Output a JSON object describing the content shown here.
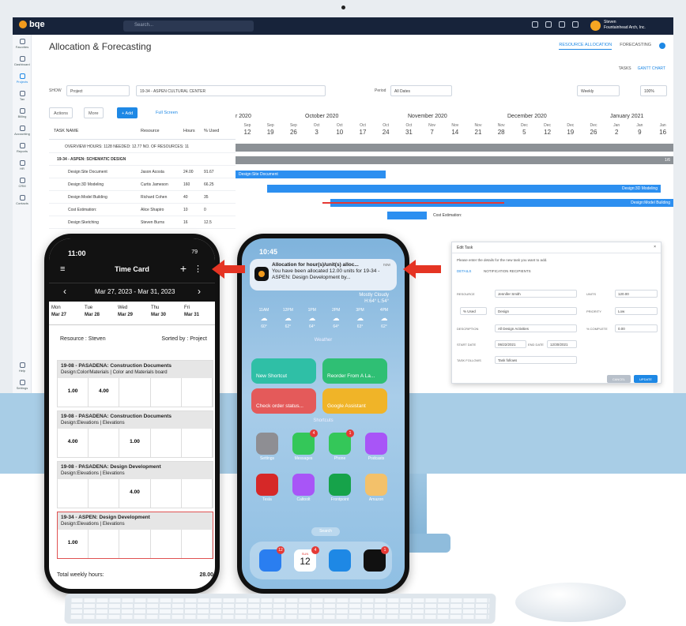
{
  "app": {
    "logo": "bqe",
    "search_placeholder": "Search...",
    "user_name": "Steven",
    "user_org": "Fountainhead Arch, Inc."
  },
  "sidebar": {
    "items": [
      "Favorites",
      "Dashboard",
      "Projects",
      "Tax",
      "Billing",
      "Accounting",
      "Reports",
      "HR",
      "CRM",
      "Contacts",
      "Help",
      "Settings"
    ]
  },
  "page": {
    "title": "Allocation & Forecasting",
    "tabs": [
      "RESOURCE ALLOCATION",
      "FORECASTING"
    ],
    "subtabs": [
      "TASKS",
      "GANTT CHART"
    ]
  },
  "filters": {
    "show_label": "SHOW",
    "show_value": "Project",
    "project": "19-34 - ASPEN CULTURAL CENTER",
    "period_label": "Period",
    "period_value": "All Dates",
    "weekly": "Weekly",
    "zoom": "100%"
  },
  "toolbar": {
    "actions": "Actions",
    "more": "More",
    "add": "+ Add",
    "fullscreen": "Full Screen"
  },
  "grid": {
    "headers": [
      "TASK NAME",
      "Resource",
      "Hours",
      "% Used"
    ],
    "overview": "OVERVIEW  HOURS: 1128  NEEDED: 12.77  NO. OF RESOURCES: 11",
    "group": "19-34 - ASPEN: SCHEMATIC DESIGN",
    "rows": [
      {
        "task": "Design:Site Document",
        "resource": "Jason Acosta",
        "hours": "24.00",
        "used": "91.67"
      },
      {
        "task": "Design:3D Modeling",
        "resource": "Curtis Jameson",
        "hours": "160",
        "used": "66.25"
      },
      {
        "task": "Design:Model Building",
        "resource": "Richard Cohen",
        "hours": "40",
        "used": "35"
      },
      {
        "task": "Cost Estimation:",
        "resource": "Alice Shapiro",
        "hours": "10",
        "used": "0"
      },
      {
        "task": "Design:Sketching",
        "resource": "Steven Burns",
        "hours": "16",
        "used": "12.5"
      }
    ]
  },
  "gantt": {
    "months": [
      "r 2020",
      "October 2020",
      "November 2020",
      "December 2020",
      "January 2021"
    ],
    "weeks": [
      [
        "Sep",
        "12"
      ],
      [
        "Sep",
        "19"
      ],
      [
        "Sep",
        "26"
      ],
      [
        "Oct",
        "3"
      ],
      [
        "Oct",
        "10"
      ],
      [
        "Oct",
        "17"
      ],
      [
        "Oct",
        "24"
      ],
      [
        "Oct",
        "31"
      ],
      [
        "Nov",
        "7"
      ],
      [
        "Nov",
        "14"
      ],
      [
        "Nov",
        "21"
      ],
      [
        "Nov",
        "28"
      ],
      [
        "Dec",
        "5"
      ],
      [
        "Dec",
        "12"
      ],
      [
        "Dec",
        "19"
      ],
      [
        "Dec",
        "26"
      ],
      [
        "Jan",
        "2"
      ],
      [
        "Jan",
        "9"
      ],
      [
        "Jan",
        "16"
      ]
    ],
    "bars": {
      "site": "Design:Site Document",
      "modeling": "Design:3D Modeling",
      "model_building": "Design:Model Building",
      "cost": "Cost Estimation:",
      "overview_end": "1/6"
    }
  },
  "dialog": {
    "title": "Edit Task",
    "instruction": "Please enter the details for the new task you want to add.",
    "tabs": [
      "DETAILS",
      "NOTIFICATION RECIPIENTS"
    ],
    "resource_label": "RESOURCE",
    "resource": "Jennifer Smith",
    "units_label": "UNITS",
    "units": "120.00",
    "unit_type": "% Used",
    "type": "Design",
    "priority_label": "PRIORITY",
    "priority": "Low",
    "description_label": "DESCRIPTION",
    "description": "All Design Activities",
    "complete_label": "% COMPLETE",
    "complete": "0.00",
    "start_label": "START DATE",
    "start": "06/22/2021",
    "end_label": "END DATE",
    "end": "12/30/2021",
    "follows_label": "TASK FOLLOWS",
    "follows": "Task follows",
    "cancel": "CANCEL",
    "update": "UPDATE"
  },
  "timecard": {
    "time": "11:00",
    "battery": "79",
    "title": "Time Card",
    "range": "Mar 27, 2023 - Mar 31, 2023",
    "days": [
      [
        "Mon",
        "Mar 27"
      ],
      [
        "Tue",
        "Mar 28"
      ],
      [
        "Wed",
        "Mar 29"
      ],
      [
        "Thu",
        "Mar 30"
      ],
      [
        "Fri",
        "Mar 31"
      ]
    ],
    "resource": "Resource : Steven",
    "sorted": "Sorted by : Project",
    "cards": [
      {
        "title": "19-08 - PASADENA: Construction Documents",
        "sub": "Design:Color/Materials | Color and Materials board",
        "v": [
          "1.00",
          "4.00",
          "",
          "",
          ""
        ]
      },
      {
        "title": "19-08 - PASADENA: Construction Documents",
        "sub": "Design:Elevations | Elevations",
        "v": [
          "4.00",
          "",
          "1.00",
          "",
          ""
        ]
      },
      {
        "title": "19-08 - PASADENA: Design Development",
        "sub": "Design:Elevations | Elevations",
        "v": [
          "",
          "",
          "4.00",
          "",
          ""
        ]
      },
      {
        "title": "19-34 - ASPEN: Design Development",
        "sub": "Design:Elevations | Elevations",
        "v": [
          "1.00",
          "",
          "",
          "",
          ""
        ]
      }
    ],
    "total_label": "Total weekly hours:",
    "total": "28.00"
  },
  "home": {
    "time": "10:45",
    "notif_title": "Allocation for hour(s)/unit(s) alloc...",
    "notif_now": "now",
    "notif_body": "You have been allocated 12.00 units  for 19-34 - ASPEN: Design Development  by...",
    "weather_desc": "Mostly Cloudy",
    "weather_hl": "H:64° L:54°",
    "hours": [
      [
        "11AM",
        "60°"
      ],
      [
        "12PM",
        "62°"
      ],
      [
        "1PM",
        "64°"
      ],
      [
        "2PM",
        "64°"
      ],
      [
        "3PM",
        "63°"
      ],
      [
        "4PM",
        "62°"
      ]
    ],
    "weather_label": "Weather",
    "shortcuts": [
      [
        "New Shortcut",
        "#2fbfa6"
      ],
      [
        "Reorder From A La...",
        "#2fbf74"
      ],
      [
        "Check order status...",
        "#e45a5a"
      ],
      [
        "Google Assistant",
        "#f0b428"
      ]
    ],
    "shortcuts_label": "Shortcuts",
    "apps": [
      [
        "Settings",
        "#8e8e93",
        ""
      ],
      [
        "Messages",
        "#34c759",
        "4"
      ],
      [
        "Phone",
        "#34c759",
        "1"
      ],
      [
        "Podcasts",
        "#a855f7",
        ""
      ],
      [
        "Tesla",
        "#d62828",
        ""
      ],
      [
        "Caltoolt",
        "#a855f7",
        ""
      ],
      [
        "Frontpoint",
        "#16a34a",
        ""
      ],
      [
        "Amazon",
        "#f3c16a",
        ""
      ]
    ],
    "search": "Search",
    "dock": [
      [
        "mail",
        "#2a7ef0",
        "12"
      ],
      [
        "calendar",
        "#ffffff",
        "4"
      ],
      [
        "safari",
        "#1e88e5",
        ""
      ],
      [
        "bqe",
        "#111111",
        "1"
      ]
    ],
    "calendar_day": "SUN",
    "calendar_date": "12"
  }
}
